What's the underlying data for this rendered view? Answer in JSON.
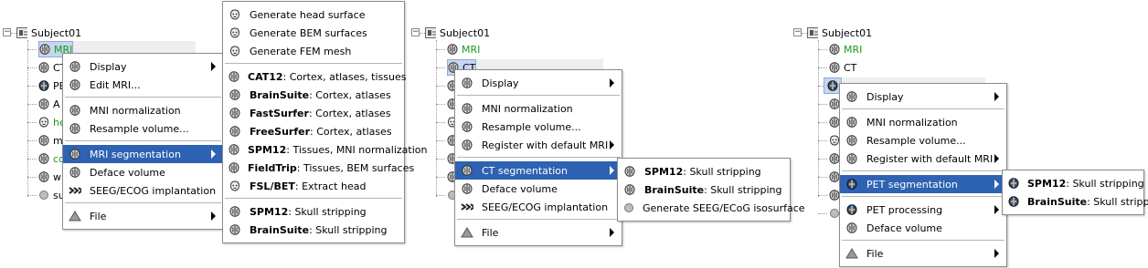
{
  "panel1": {
    "subject": "Subject01",
    "items": [
      "MRI",
      "CT",
      "PET",
      "A",
      "he",
      "mi",
      "co",
      "w",
      "su"
    ],
    "context_menu": [
      {
        "label": "Display",
        "icon": "brain-icon",
        "submenu": true
      },
      {
        "label": "Edit MRI...",
        "icon": "brain-icon",
        "submenu": false
      },
      {
        "sep": true
      },
      {
        "label": "MNI normalization",
        "icon": "brain-icon",
        "submenu": false
      },
      {
        "label": "Resample volume...",
        "icon": "brain-icon",
        "submenu": false
      },
      {
        "sep": true
      },
      {
        "label": "MRI segmentation",
        "icon": "brain-icon",
        "submenu": true,
        "highlight": true
      },
      {
        "label": "Deface volume",
        "icon": "brain-icon",
        "submenu": false
      },
      {
        "label": "SEEG/ECOG implantation",
        "icon": "seeg-icon",
        "submenu": false
      },
      {
        "sep": true
      },
      {
        "label": "File",
        "icon": "file-icon",
        "submenu": true
      }
    ],
    "submenu": [
      {
        "bold": "",
        "rest": "Generate head surface",
        "icon": "head-icon"
      },
      {
        "bold": "",
        "rest": "Generate BEM surfaces",
        "icon": "head-icon"
      },
      {
        "bold": "",
        "rest": "Generate FEM mesh",
        "icon": "head-icon"
      },
      {
        "sep": true
      },
      {
        "bold": "CAT12",
        "rest": ": Cortex, atlases, tissues",
        "icon": "brain-icon"
      },
      {
        "bold": "BrainSuite",
        "rest": ": Cortex, atlases",
        "icon": "brain-icon"
      },
      {
        "bold": "FastSurfer",
        "rest": ": Cortex, atlases",
        "icon": "brain-icon"
      },
      {
        "bold": "FreeSurfer",
        "rest": ": Cortex, atlases",
        "icon": "brain-icon"
      },
      {
        "bold": "SPM12",
        "rest": ": Tissues, MNI normalization",
        "icon": "brain-icon"
      },
      {
        "bold": "FieldTrip",
        "rest": ": Tissues, BEM surfaces",
        "icon": "brain-icon"
      },
      {
        "bold": "FSL/BET",
        "rest": ": Extract head",
        "icon": "head-icon"
      },
      {
        "sep": true
      },
      {
        "bold": "SPM12",
        "rest": ": Skull stripping",
        "icon": "brain-icon"
      },
      {
        "bold": "BrainSuite",
        "rest": ": Skull stripping",
        "icon": "brain-icon"
      }
    ]
  },
  "panel2": {
    "subject": "Subject01",
    "items": [
      "MRI",
      "CT"
    ],
    "context_menu": [
      {
        "label": "Display",
        "icon": "brain-icon",
        "submenu": true
      },
      {
        "sep": true
      },
      {
        "label": "MNI normalization",
        "icon": "brain-icon",
        "submenu": false
      },
      {
        "label": "Resample volume...",
        "icon": "brain-icon",
        "submenu": false
      },
      {
        "label": "Register with default MRI",
        "icon": "brain-icon",
        "submenu": true
      },
      {
        "sep": true
      },
      {
        "label": "CT segmentation",
        "icon": "brain-icon",
        "submenu": true,
        "highlight": true
      },
      {
        "label": "Deface volume",
        "icon": "brain-icon",
        "submenu": false
      },
      {
        "label": "SEEG/ECOG implantation",
        "icon": "seeg-icon",
        "submenu": false
      },
      {
        "sep": true
      },
      {
        "label": "File",
        "icon": "file-icon",
        "submenu": true
      }
    ],
    "submenu": [
      {
        "bold": "SPM12",
        "rest": ": Skull stripping",
        "icon": "brain-icon"
      },
      {
        "bold": "BrainSuite",
        "rest": ": Skull stripping",
        "icon": "brain-icon"
      },
      {
        "bold": "",
        "rest": "Generate SEEG/ECoG isosurface",
        "icon": "sphere-icon"
      }
    ]
  },
  "panel3": {
    "subject": "Subject01",
    "items": [
      "MRI",
      "CT"
    ],
    "context_menu": [
      {
        "label": "Display",
        "icon": "brain-icon",
        "submenu": true
      },
      {
        "sep": true
      },
      {
        "label": "MNI normalization",
        "icon": "brain-icon",
        "submenu": false
      },
      {
        "label": "Resample volume...",
        "icon": "brain-icon",
        "submenu": false
      },
      {
        "label": "Register with default MRI",
        "icon": "brain-icon",
        "submenu": true
      },
      {
        "sep": true
      },
      {
        "label": "PET segmentation",
        "icon": "pet-icon",
        "submenu": true,
        "highlight": true
      },
      {
        "sep": true
      },
      {
        "label": "PET processing",
        "icon": "pet-icon",
        "submenu": true
      },
      {
        "label": "Deface volume",
        "icon": "brain-icon",
        "submenu": false
      },
      {
        "sep": true
      },
      {
        "label": "File",
        "icon": "file-icon",
        "submenu": true
      }
    ],
    "submenu": [
      {
        "bold": "SPM12",
        "rest": ": Skull stripping",
        "icon": "pet-icon"
      },
      {
        "bold": "BrainSuite",
        "rest": ": Skull stripping",
        "icon": "pet-icon"
      }
    ]
  }
}
